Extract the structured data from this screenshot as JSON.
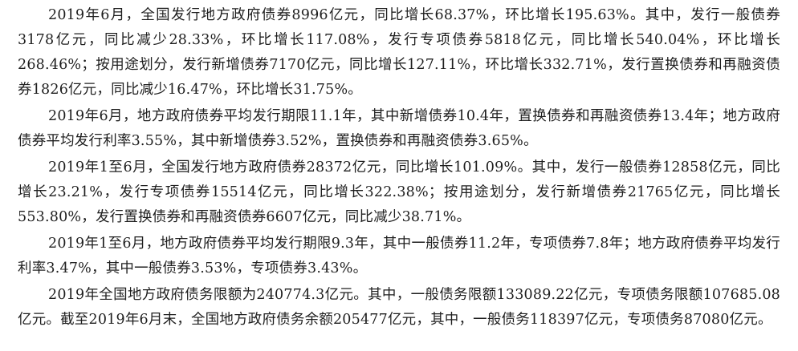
{
  "paragraphs": [
    "2019年6月，全国发行地方政府债券8996亿元，同比增长68.37%，环比增长195.63%。其中，发行一般债券3178亿元，同比减少28.33%，环比增长117.08%，发行专项债券5818亿元，同比增长540.04%，环比增长268.46%；按用途划分，发行新增债券7170亿元，同比增长127.11%，环比增长332.71%，发行置换债券和再融资债券1826亿元，同比减少16.47%，环比增长31.75%。",
    "2019年6月，地方政府债券平均发行期限11.1年，其中新增债券10.4年，置换债券和再融资债券13.4年；地方政府债券平均发行利率3.55%，其中新增债券3.52%，置换债券和再融资债券3.65%。",
    "2019年1至6月，全国发行地方政府债券28372亿元，同比增长101.09%。其中，发行一般债券12858亿元，同比增长23.21%，发行专项债券15514亿元，同比增长322.38%；按用途划分，发行新增债券21765亿元，同比增长553.80%，发行置换债券和再融资债券6607亿元，同比减少38.71%。",
    "2019年1至6月，地方政府债券平均发行期限9.3年，其中一般债券11.2年，专项债券7.8年；地方政府债券平均发行利率3.47%，其中一般债券3.53%，专项债券3.43%。",
    "2019年全国地方政府债务限额为240774.3亿元。其中，一般债务限额133089.22亿元，专项债务限额107685.08亿元。截至2019年6月末，全国地方政府债务余额205477亿元，其中，一般债务118397亿元，专项债务87080亿元。"
  ]
}
